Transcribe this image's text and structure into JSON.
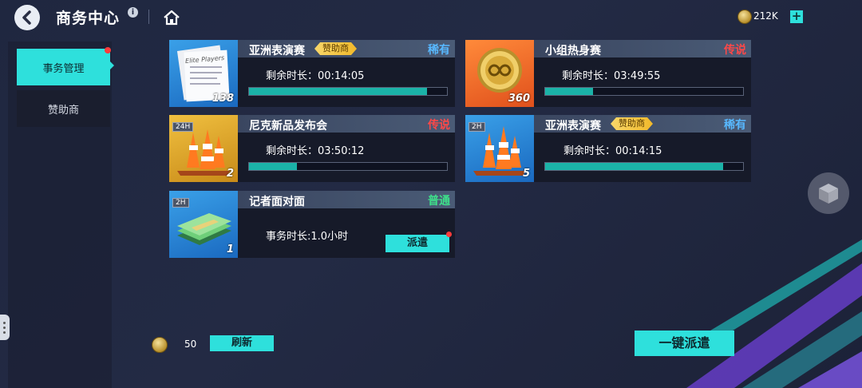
{
  "header": {
    "title": "商务中心",
    "currency_value": "212K"
  },
  "sidebar": {
    "items": [
      {
        "label": "事务管理",
        "active": true
      },
      {
        "label": "赞助商",
        "active": false
      }
    ]
  },
  "cards": [
    {
      "name": "亚洲表演赛",
      "badge": "赞助商",
      "rarity": "稀有",
      "timer": "剩余时长：00:14:05",
      "progress": 0.9,
      "count": "138",
      "thumb_label": "Elite Players"
    },
    {
      "name": "小组热身赛",
      "rarity": "传说",
      "timer": "剩余时长：03:49:55",
      "progress": 0.24,
      "count": "360"
    },
    {
      "name": "尼克新品发布会",
      "rarity": "传说",
      "timer": "剩余时长：03:50:12",
      "progress": 0.24,
      "count": "2",
      "tag": "24H"
    },
    {
      "name": "亚洲表演赛",
      "badge": "赞助商",
      "rarity": "稀有",
      "timer": "剩余时长：00:14:15",
      "progress": 0.9,
      "count": "5",
      "tag": "2H"
    },
    {
      "name": "记者面对面",
      "rarity": "普通",
      "timer": "事务时长:1.0小时",
      "count": "1",
      "tag": "2H",
      "button": "派遣"
    }
  ],
  "footer": {
    "refresh_cost": "50",
    "refresh_label": "刷新",
    "dispatch_all_label": "一键派遣"
  },
  "colors": {
    "accent": "#2ee0dc",
    "rare": "#58b8ff",
    "legend": "#ff4848",
    "normal": "#3ee08a",
    "progress": "#1bb3a8"
  }
}
